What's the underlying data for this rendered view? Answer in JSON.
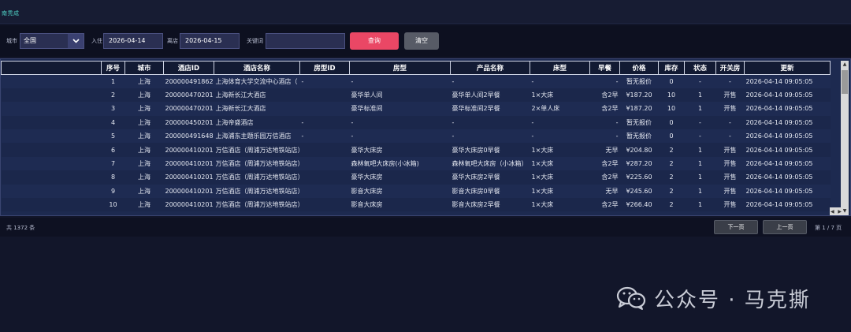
{
  "app": {
    "title": "南秃成"
  },
  "filters": {
    "city_label": "城市",
    "city_value": "全国",
    "checkin_label": "入住",
    "checkin_value": "2026-04-14",
    "checkout_label": "离店",
    "checkout_value": "2026-04-15",
    "keyword_label": "关键词",
    "keyword_value": "",
    "query_button": "查询",
    "clear_button": "清空"
  },
  "table": {
    "headers": [
      "",
      "序号",
      "城市",
      "酒店ID",
      "酒店名称",
      "房型ID",
      "房型",
      "产品名称",
      "床型",
      "早餐",
      "价格",
      "库存",
      "状态",
      "开关房",
      "更新"
    ],
    "rows": [
      [
        "",
        "1",
        "上海",
        "200000491862",
        "上海体育大学交流中心酒店（",
        "-",
        "-",
        "-",
        "-",
        "-",
        "暂无报价",
        "0",
        "-",
        "-",
        "2026-04-14 09:05:05"
      ],
      [
        "",
        "2",
        "上海",
        "200000470201",
        "上海新长江大酒店",
        "",
        "豪华单人间",
        "豪华单人间2早餐",
        "1×大床",
        "含2早",
        "¥187.20",
        "10",
        "1",
        "开售",
        "2026-04-14 09:05:05"
      ],
      [
        "",
        "3",
        "上海",
        "200000470201",
        "上海新长江大酒店",
        "",
        "豪华标准间",
        "豪华标准间2早餐",
        "2×单人床",
        "含2早",
        "¥187.20",
        "10",
        "1",
        "开售",
        "2026-04-14 09:05:05"
      ],
      [
        "",
        "4",
        "上海",
        "200000450201",
        "上海帝盛酒店",
        "-",
        "-",
        "-",
        "-",
        "-",
        "暂无报价",
        "0",
        "-",
        "-",
        "2026-04-14 09:05:05"
      ],
      [
        "",
        "5",
        "上海",
        "200000491648",
        "上海浦东主题乐园万信酒店",
        "-",
        "-",
        "-",
        "-",
        "-",
        "暂无报价",
        "0",
        "-",
        "-",
        "2026-04-14 09:05:05"
      ],
      [
        "",
        "6",
        "上海",
        "200000410201",
        "万信酒店（周浦万达地铁站店）",
        "",
        "豪华大床房",
        "豪华大床房0早餐",
        "1×大床",
        "无早",
        "¥204.80",
        "2",
        "1",
        "开售",
        "2026-04-14 09:05:05"
      ],
      [
        "",
        "7",
        "上海",
        "200000410201",
        "万信酒店（周浦万达地铁站店）",
        "",
        "森林氧吧大床房(小冰箱)",
        "森林氧吧大床房（小冰箱）",
        "1×大床",
        "含2早",
        "¥287.20",
        "2",
        "1",
        "开售",
        "2026-04-14 09:05:05"
      ],
      [
        "",
        "8",
        "上海",
        "200000410201",
        "万信酒店（周浦万达地铁站店）",
        "",
        "豪华大床房",
        "豪华大床房2早餐",
        "1×大床",
        "含2早",
        "¥225.60",
        "2",
        "1",
        "开售",
        "2026-04-14 09:05:05"
      ],
      [
        "",
        "9",
        "上海",
        "200000410201",
        "万信酒店（周浦万达地铁站店）",
        "",
        "影音大床房",
        "影音大床房0早餐",
        "1×大床",
        "无早",
        "¥245.60",
        "2",
        "1",
        "开售",
        "2026-04-14 09:05:05"
      ],
      [
        "",
        "10",
        "上海",
        "200000410201",
        "万信酒店（周浦万达地铁站店）",
        "",
        "影音大床房",
        "影音大床房2早餐",
        "1×大床",
        "含2早",
        "¥266.40",
        "2",
        "1",
        "开售",
        "2026-04-14 09:05:05"
      ]
    ]
  },
  "footer": {
    "total": "共 1372 条",
    "next_button": "下一页",
    "prev_button": "上一页",
    "page_info": "第 1 / 7 页"
  },
  "watermark": {
    "text": "公众号 · 马克撕",
    "icon": "wechat-icon"
  }
}
